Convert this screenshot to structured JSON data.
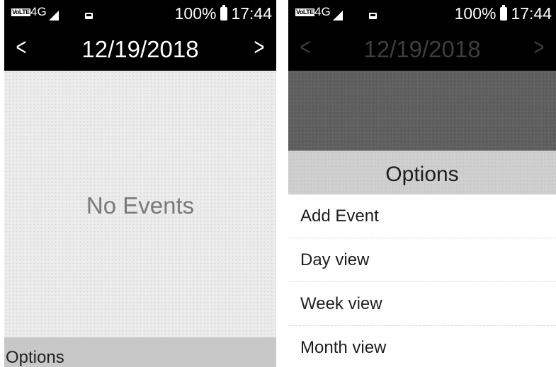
{
  "status_bar": {
    "volte": "VoLTE",
    "network": "4G",
    "battery": "100%",
    "time": "17:44"
  },
  "date": "12/19/2018",
  "nav": {
    "prev": "<",
    "next": ">"
  },
  "left_screen": {
    "empty_message": "No Events",
    "softkey_left": "Options"
  },
  "options_menu": {
    "title": "Options",
    "items": [
      {
        "label": "Add Event"
      },
      {
        "label": "Day view"
      },
      {
        "label": "Week view"
      },
      {
        "label": "Month view"
      }
    ]
  },
  "icons": [
    "volte-icon",
    "signal-icon",
    "message-icon",
    "battery-icon",
    "chevron-left-icon",
    "chevron-right-icon"
  ]
}
